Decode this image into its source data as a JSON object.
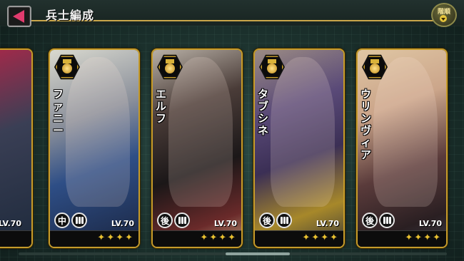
{
  "header": {
    "title": "兵士編成",
    "sort_label": "階順"
  },
  "cards": [
    {
      "name": "",
      "position": "",
      "level": "LV.70",
      "partial": true
    },
    {
      "name": "ファニー",
      "position": "中",
      "level": "LV.70",
      "stars": "✦✦✦✦"
    },
    {
      "name": "エルフ",
      "position": "後",
      "level": "LV.70",
      "stars": "✦✦✦✦"
    },
    {
      "name": "タブシネ",
      "position": "後",
      "level": "LV.70",
      "stars": "✦✦✦✦"
    },
    {
      "name": "ウリンヴィア",
      "position": "後",
      "level": "LV.70",
      "stars": "✦✦✦✦"
    }
  ],
  "colors": {
    "accent": "#c59b2b",
    "back_arrow": "#e23b6e"
  }
}
